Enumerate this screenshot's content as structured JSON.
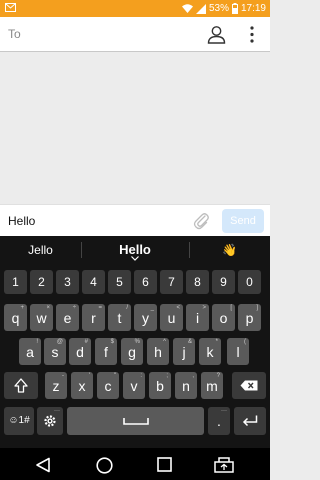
{
  "status_bar": {
    "battery": "53%",
    "time": "17:19"
  },
  "recipient": {
    "label": "To"
  },
  "compose": {
    "text": "Hello",
    "send_label": "Send"
  },
  "suggestions": [
    "Jello",
    "Hello",
    "👋"
  ],
  "keyboard": {
    "number_row": [
      "1",
      "2",
      "3",
      "4",
      "5",
      "6",
      "7",
      "8",
      "9",
      "0"
    ],
    "row1": [
      {
        "key": "q",
        "sub": "+"
      },
      {
        "key": "w",
        "sub": "×"
      },
      {
        "key": "e",
        "sub": "÷"
      },
      {
        "key": "r",
        "sub": "="
      },
      {
        "key": "t",
        "sub": "/"
      },
      {
        "key": "y",
        "sub": "_"
      },
      {
        "key": "u",
        "sub": "<"
      },
      {
        "key": "i",
        "sub": ">"
      },
      {
        "key": "o",
        "sub": "["
      },
      {
        "key": "p",
        "sub": "]"
      }
    ],
    "row2": [
      {
        "key": "a",
        "sub": "!"
      },
      {
        "key": "s",
        "sub": "@"
      },
      {
        "key": "d",
        "sub": "#"
      },
      {
        "key": "f",
        "sub": "$"
      },
      {
        "key": "g",
        "sub": "%"
      },
      {
        "key": "h",
        "sub": "^"
      },
      {
        "key": "j",
        "sub": "&"
      },
      {
        "key": "k",
        "sub": "*"
      },
      {
        "key": "l",
        "sub": "("
      }
    ],
    "row3": [
      {
        "key": "z",
        "sub": "-"
      },
      {
        "key": "x",
        "sub": "'"
      },
      {
        "key": "c",
        "sub": "\""
      },
      {
        "key": "v",
        "sub": ":"
      },
      {
        "key": "b",
        "sub": ";"
      },
      {
        "key": "n",
        "sub": ","
      },
      {
        "key": "m",
        "sub": "?"
      }
    ],
    "symbols_label": "☺1#",
    "period_label": "."
  }
}
